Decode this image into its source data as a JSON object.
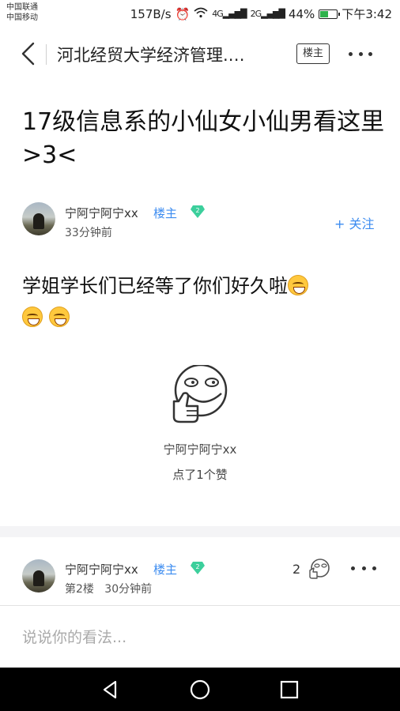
{
  "status_bar": {
    "carrier_1": "中国联通",
    "carrier_2": "中国移动",
    "net_speed": "157B/s",
    "signal_1": "4G",
    "signal_2": "2G",
    "battery": "44%",
    "battery_level": 0.44,
    "time": "下午3:42"
  },
  "nav": {
    "title": "河北经贸大学经济管理.…",
    "lz_button": "楼主"
  },
  "post": {
    "title": "17级信息系的小仙女小仙男看这里>3<",
    "author": "宁阿宁阿宁xx",
    "lz_badge": "楼主",
    "level": "2",
    "time": "33分钟前",
    "follow": "+ 关注",
    "body": "学姐学长们已经等了你们好久啦"
  },
  "likes": {
    "user": "宁阿宁阿宁xx",
    "text": "点了1个赞"
  },
  "reply": {
    "author": "宁阿宁阿宁xx",
    "lz_badge": "楼主",
    "level": "2",
    "floor": "第2楼",
    "time": "30分钟前",
    "like_count": "2"
  },
  "comment_box": {
    "placeholder": "说说你的看法..."
  },
  "colors": {
    "accent": "#3c8cf0",
    "level_badge": "#3ccf9c",
    "battery_fill": "#2fb24c"
  }
}
